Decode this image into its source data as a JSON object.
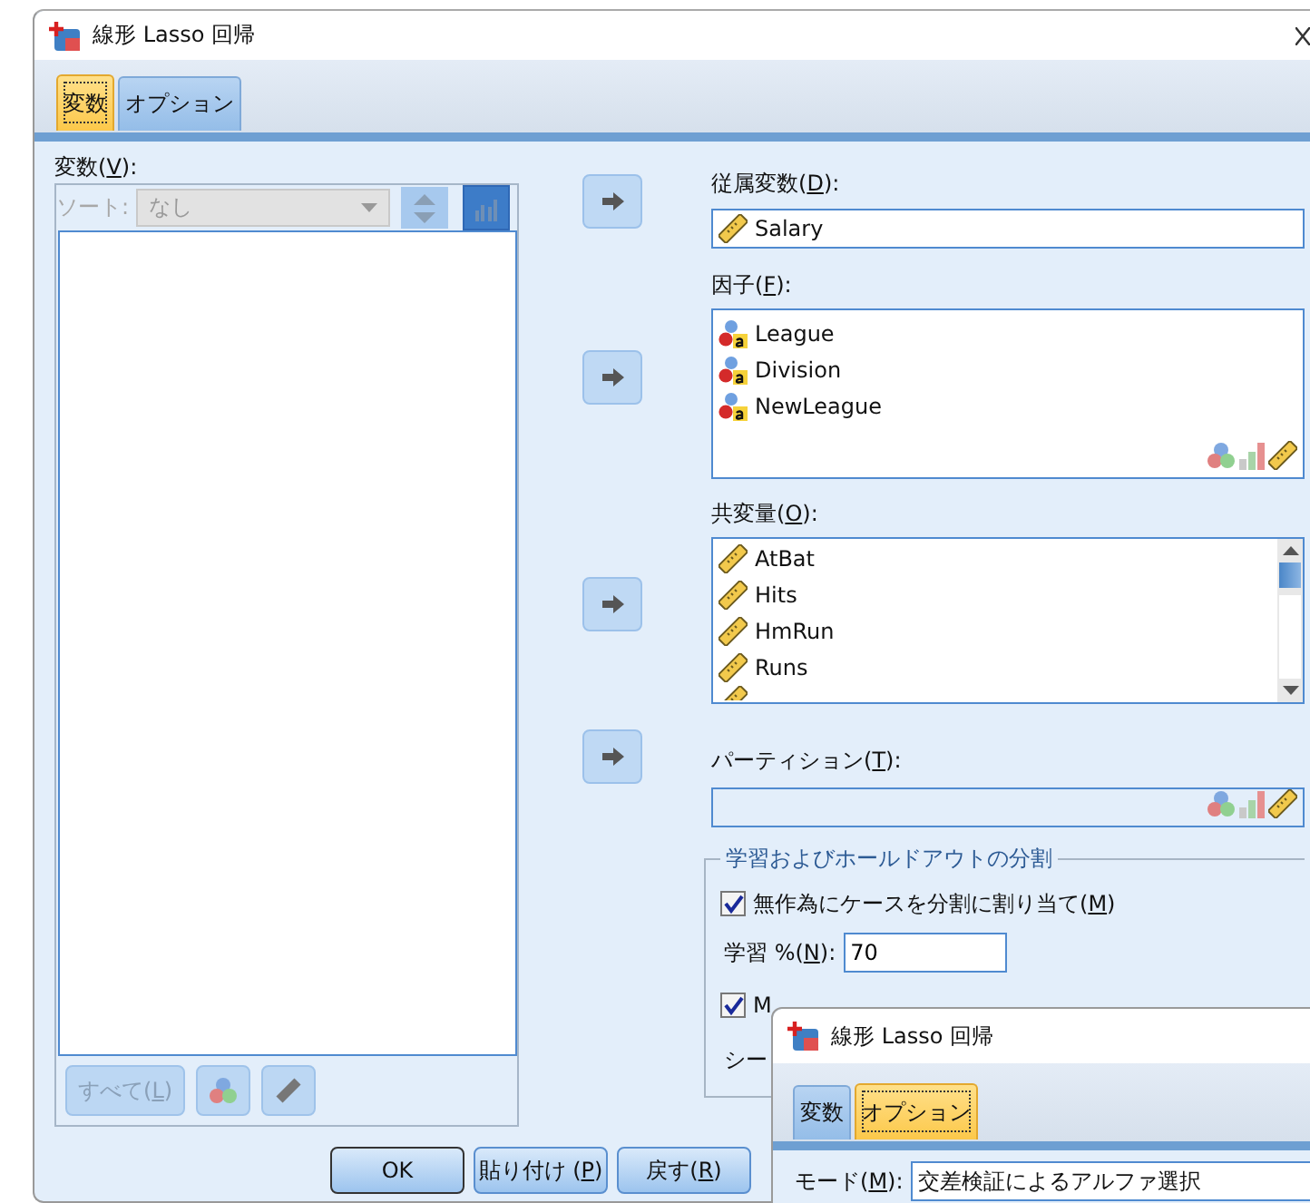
{
  "window": {
    "title": "線形 Lasso 回帰"
  },
  "tabs": [
    {
      "label": "変数",
      "selected": true
    },
    {
      "label": "オプション",
      "selected": false
    }
  ],
  "variables_panel": {
    "label": {
      "pre": "変数(",
      "key": "V",
      "post": "):"
    },
    "sort_label": "ソート:",
    "sort_value": "なし",
    "disabled": true,
    "buttons": [
      {
        "kind": "text",
        "label": {
          "pre": "すべて(",
          "key": "L",
          "post": ")"
        }
      },
      {
        "kind": "nominal"
      },
      {
        "kind": "scale"
      }
    ]
  },
  "dependent": {
    "label": {
      "pre": "従属変数(",
      "key": "D",
      "post": "):"
    },
    "items": [
      {
        "name": "Salary",
        "kind": "scale"
      }
    ]
  },
  "factors": {
    "label": {
      "pre": "因子(",
      "key": "F",
      "post": "):"
    },
    "items": [
      {
        "name": "League",
        "kind": "nominal"
      },
      {
        "name": "Division",
        "kind": "nominal"
      },
      {
        "name": "NewLeague",
        "kind": "nominal"
      }
    ]
  },
  "covariates": {
    "label": {
      "pre": "共変量(",
      "key": "O",
      "post": "):"
    },
    "items": [
      {
        "name": "AtBat",
        "kind": "scale"
      },
      {
        "name": "Hits",
        "kind": "scale"
      },
      {
        "name": "HmRun",
        "kind": "scale"
      },
      {
        "name": "Runs",
        "kind": "scale"
      }
    ]
  },
  "partition": {
    "label": {
      "pre": "パーティション(",
      "key": "T",
      "post": "):"
    }
  },
  "split_group": {
    "title": "学習およびホールドアウトの分割",
    "random_assign": {
      "label": {
        "pre": "無作為にケースを分割に割り当て(",
        "key": "M",
        "post": ")"
      },
      "checked": true
    },
    "training_percent": {
      "label": {
        "pre": "学習 %(",
        "key": "N",
        "post": "):"
      },
      "value": "70"
    },
    "option_2": {
      "label": "M",
      "checked": true
    },
    "option_3": {
      "label": "シー"
    }
  },
  "buttons": [
    {
      "label": {
        "pre": "OK"
      },
      "default": true
    },
    {
      "label": {
        "pre": "貼り付け (",
        "key": "P",
        "post": ")"
      },
      "default": false
    },
    {
      "label": {
        "pre": "戻す(",
        "key": "R",
        "post": ")"
      },
      "default": false
    }
  ],
  "overlay_dialog": {
    "title": "線形 Lasso 回帰",
    "tabs": [
      {
        "label": "変数",
        "selected": false
      },
      {
        "label": "オプション",
        "selected": true
      }
    ],
    "mode": {
      "label": {
        "pre": "モード(",
        "key": "M",
        "post": "):"
      },
      "value": "交差検証によるアルファ選択"
    }
  }
}
